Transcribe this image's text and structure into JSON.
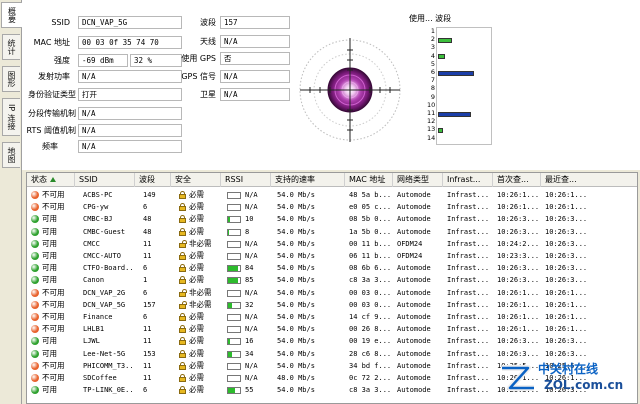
{
  "tabs": [
    {
      "label": "概要",
      "active": true
    },
    {
      "label": "统计",
      "active": false
    },
    {
      "label": "图形",
      "active": false
    },
    {
      "label": "IP 连接",
      "active": false
    },
    {
      "label": "地图",
      "active": false
    }
  ],
  "info": {
    "ssid_label": "SSID",
    "ssid_value": "DCN_VAP_5G",
    "mac_label": "MAC 地址",
    "mac_value": "00 03 0f 35 74 70",
    "strength_label": "强度",
    "strength_dbm": "-69 dBm",
    "strength_pct": "32 %",
    "txpower_label": "发射功率",
    "txpower_value": "N/A",
    "auth_label": "身份验证类型",
    "auth_value": "打开",
    "frag_label": "分段传输机制",
    "frag_value": "N/A",
    "rts_label": "RTS 阈值机制",
    "rts_value": "N/A",
    "freq_label": "频率",
    "freq_value": "N/A",
    "channel_label": "波段",
    "channel_value": "157",
    "antenna_label": "天线",
    "antenna_value": "N/A",
    "gps_label": "使用 GPS",
    "gps_value": "否",
    "gps_signal_label": "GPS 信号",
    "gps_signal_value": "N/A",
    "satellite_label": "卫星",
    "satellite_value": "N/A"
  },
  "band_panel": {
    "title": "使用... 波段",
    "channels": [
      "1",
      "2",
      "3",
      "4",
      "5",
      "6",
      "7",
      "8",
      "9",
      "10",
      "11",
      "12",
      "13",
      "14"
    ],
    "usage": [
      0,
      0.4,
      0,
      0.2,
      0,
      1.0,
      0,
      0,
      0,
      0,
      0.92,
      0,
      0.15,
      0
    ]
  },
  "colors": {
    "available": "#2ea12e",
    "unavailable": "#e8612c",
    "band_bar": "#1b3ea8",
    "band_green": "#3cbf3c"
  },
  "table": {
    "headers": [
      "状态",
      "SSID",
      "波段",
      "安全",
      "RSSI",
      "支持的速率",
      "MAC 地址",
      "网络类型",
      "Infrast...",
      "首次查...",
      "最近查..."
    ],
    "rows": [
      {
        "status": "不可用",
        "ok": false,
        "ssid": "ACBS-PC",
        "ch": "149",
        "sec": "必需",
        "secure": true,
        "rssi": "N/A",
        "rssi_level": 0,
        "rate": "54.0 Mb/s",
        "mac": "48 5a b...",
        "mode": "Automode",
        "infra": "Infrast...",
        "first": "10:26:1...",
        "last": "10:26:1..."
      },
      {
        "status": "不可用",
        "ok": false,
        "ssid": "CPG-yw",
        "ch": "6",
        "sec": "必需",
        "secure": true,
        "rssi": "N/A",
        "rssi_level": 0,
        "rate": "54.0 Mb/s",
        "mac": "e0 05 c...",
        "mode": "Automode",
        "infra": "Infrast...",
        "first": "10:26:1...",
        "last": "10:26:1..."
      },
      {
        "status": "可用",
        "ok": true,
        "ssid": "CMBC-BJ",
        "ch": "48",
        "sec": "必需",
        "secure": true,
        "rssi": "10",
        "rssi_level": 0.15,
        "rate": "54.0 Mb/s",
        "mac": "08 5b 0...",
        "mode": "Automode",
        "infra": "Infrast...",
        "first": "10:26:3...",
        "last": "10:26:3..."
      },
      {
        "status": "可用",
        "ok": true,
        "ssid": "CMBC-Guest",
        "ch": "48",
        "sec": "必需",
        "secure": true,
        "rssi": "8",
        "rssi_level": 0.1,
        "rate": "54.0 Mb/s",
        "mac": "1a 5b 0...",
        "mode": "Automode",
        "infra": "Infrast...",
        "first": "10:26:3...",
        "last": "10:26:3..."
      },
      {
        "status": "可用",
        "ok": true,
        "ssid": "CMCC",
        "ch": "11",
        "sec": "非必需",
        "secure": false,
        "rssi": "N/A",
        "rssi_level": 0,
        "rate": "54.0 Mb/s",
        "mac": "00 11 b...",
        "mode": "OFDM24",
        "infra": "Infrast...",
        "first": "10:24:2...",
        "last": "10:26:3..."
      },
      {
        "status": "可用",
        "ok": true,
        "ssid": "CMCC-AUTO",
        "ch": "11",
        "sec": "必需",
        "secure": true,
        "rssi": "N/A",
        "rssi_level": 0,
        "rate": "54.0 Mb/s",
        "mac": "06 11 b...",
        "mode": "OFDM24",
        "infra": "Infrast...",
        "first": "10:23:3...",
        "last": "10:26:3..."
      },
      {
        "status": "可用",
        "ok": true,
        "ssid": "CTFO-Board...",
        "ch": "6",
        "sec": "必需",
        "secure": true,
        "rssi": "84",
        "rssi_level": 0.85,
        "rate": "54.0 Mb/s",
        "mac": "08 6b 6...",
        "mode": "Automode",
        "infra": "Infrast...",
        "first": "10:26:3...",
        "last": "10:26:3..."
      },
      {
        "status": "可用",
        "ok": true,
        "ssid": "Canon",
        "ch": "1",
        "sec": "必需",
        "secure": true,
        "rssi": "85",
        "rssi_level": 0.86,
        "rate": "54.0 Mb/s",
        "mac": "c8 3a 3...",
        "mode": "Automode",
        "infra": "Infrast...",
        "first": "10:26:3...",
        "last": "10:26:3..."
      },
      {
        "status": "不可用",
        "ok": false,
        "ssid": "DCN_VAP_2G",
        "ch": "6",
        "sec": "非必需",
        "secure": false,
        "rssi": "N/A",
        "rssi_level": 0,
        "rate": "54.0 Mb/s",
        "mac": "00 03 0...",
        "mode": "Automode",
        "infra": "Infrast...",
        "first": "10:26:1...",
        "last": "10:26:1..."
      },
      {
        "status": "不可用",
        "ok": false,
        "ssid": "DCN_VAP_5G",
        "ch": "157",
        "sec": "非必需",
        "secure": false,
        "rssi": "32",
        "rssi_level": 0.32,
        "rate": "54.0 Mb/s",
        "mac": "00 03 0...",
        "mode": "Automode",
        "infra": "Infrast...",
        "first": "10:26:1...",
        "last": "10:26:1..."
      },
      {
        "status": "不可用",
        "ok": false,
        "ssid": "Finance",
        "ch": "6",
        "sec": "必需",
        "secure": true,
        "rssi": "N/A",
        "rssi_level": 0,
        "rate": "54.0 Mb/s",
        "mac": "14 cf 9...",
        "mode": "Automode",
        "infra": "Infrast...",
        "first": "10:26:1...",
        "last": "10:26:1..."
      },
      {
        "status": "不可用",
        "ok": false,
        "ssid": "LHLB1",
        "ch": "11",
        "sec": "必需",
        "secure": true,
        "rssi": "N/A",
        "rssi_level": 0,
        "rate": "54.0 Mb/s",
        "mac": "00 26 8...",
        "mode": "Automode",
        "infra": "Infrast...",
        "first": "10:26:1...",
        "last": "10:26:1..."
      },
      {
        "status": "可用",
        "ok": true,
        "ssid": "LJWL",
        "ch": "11",
        "sec": "必需",
        "secure": true,
        "rssi": "16",
        "rssi_level": 0.16,
        "rate": "54.0 Mb/s",
        "mac": "00 19 e...",
        "mode": "Automode",
        "infra": "Infrast...",
        "first": "10:26:3...",
        "last": "10:26:3..."
      },
      {
        "status": "可用",
        "ok": true,
        "ssid": "Lee-Net-5G",
        "ch": "153",
        "sec": "必需",
        "secure": true,
        "rssi": "34",
        "rssi_level": 0.34,
        "rate": "54.0 Mb/s",
        "mac": "28 c6 8...",
        "mode": "Automode",
        "infra": "Infrast...",
        "first": "10:26:3...",
        "last": "10:26:3..."
      },
      {
        "status": "不可用",
        "ok": false,
        "ssid": "PHICOMM_T3...",
        "ch": "11",
        "sec": "必需",
        "secure": true,
        "rssi": "N/A",
        "rssi_level": 0,
        "rate": "54.0 Mb/s",
        "mac": "34 bd f...",
        "mode": "Automode",
        "infra": "Infrast...",
        "first": "10:25:5...",
        "last": "10:25:5..."
      },
      {
        "status": "不可用",
        "ok": false,
        "ssid": "SDCoffee",
        "ch": "11",
        "sec": "必需",
        "secure": true,
        "rssi": "N/A",
        "rssi_level": 0,
        "rate": "48.0 Mb/s",
        "mac": "0c 72 2...",
        "mode": "Automode",
        "infra": "Infrast...",
        "first": "10:26:1...",
        "last": "10:26:1..."
      },
      {
        "status": "可用",
        "ok": true,
        "ssid": "TP-LINK_0E...",
        "ch": "6",
        "sec": "必需",
        "secure": true,
        "rssi": "55",
        "rssi_level": 0.55,
        "rate": "54.0 Mb/s",
        "mac": "c8 3a 3...",
        "mode": "Automode",
        "infra": "Infrast...",
        "first": "10:26:3...",
        "last": "10:26:3..."
      }
    ]
  },
  "watermark": {
    "brand": "中关村在线",
    "site": "ZOL.com.cn"
  }
}
